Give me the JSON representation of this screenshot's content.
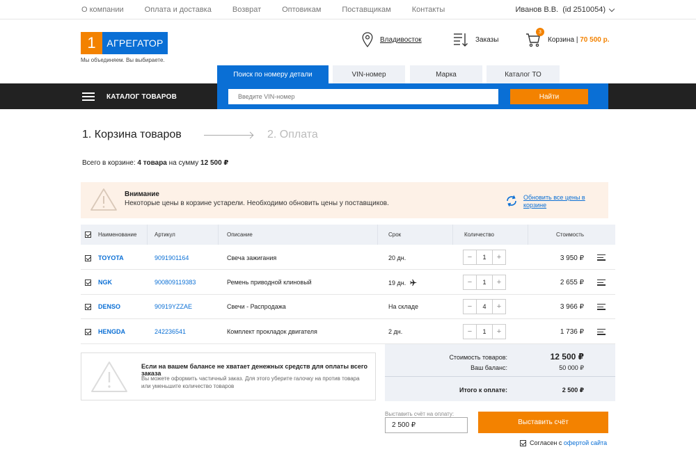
{
  "topnav": [
    "О компании",
    "Оплата и доставка",
    "Возврат",
    "Оптовикам",
    "Поставщикам",
    "Контакты"
  ],
  "user": "Иванов В.В.  (id 2510054)",
  "logo": {
    "num": "1",
    "name": "АГРЕГАТОР",
    "slogan": "Мы объединяем. Вы выбираете."
  },
  "header": {
    "city": "Владивосток",
    "orders": "Заказы",
    "cart_label": "Корзина",
    "cart_sep": " | ",
    "cart_sum": "70 500 р.",
    "cart_count": "3"
  },
  "tabs": [
    "Поиск по номеру детали",
    "VIN-номер",
    "Марка",
    "Каталог ТО"
  ],
  "catalog_label": "КАТАЛОГ ТОВАРОВ",
  "search": {
    "placeholder": "Введите VIN-номер",
    "button": "Найти"
  },
  "steps": {
    "step1": "1. Корзина товаров",
    "step2": "2. Оплата"
  },
  "summary": {
    "prefix": "Всего в корзине: ",
    "count": "4 товара",
    "mid": " на сумму ",
    "sum": "12 500 ₽"
  },
  "warning": {
    "title": "Внимание",
    "text": "Некоторые цены в корзине устарели. Необходимо обновить цены у поставщиков.",
    "refresh": "Обновить все цены в корзине"
  },
  "table": {
    "headers": {
      "name": "Наименование",
      "article": "Артикул",
      "desc": "Описание",
      "term": "Срок",
      "qty": "Количество",
      "cost": "Стоимость"
    },
    "rows": [
      {
        "brand": "TOYOTA",
        "article": "9091901164",
        "desc": "Свеча зажигания",
        "term": "20 дн.",
        "qty": "1",
        "price": "3 950 ₽"
      },
      {
        "brand": "NGK",
        "article": "900809119383",
        "desc": "Ремень приводной клиновый",
        "term": "19 дн.",
        "qty": "1",
        "price": "2 655 ₽"
      },
      {
        "brand": "DENSO",
        "article": "90919YZZAE",
        "desc": "Свечи - Распродажа",
        "term": "На складе",
        "qty": "4",
        "price": "3 966 ₽"
      },
      {
        "brand": "HENGDA",
        "article": "242236541",
        "desc": "Комплект прокладок двигателя",
        "term": "2 дн.",
        "qty": "1",
        "price": "1 736 ₽"
      }
    ]
  },
  "notice": {
    "title": "Если на вашем балансе не хватает денежных средств для оплаты всего заказа",
    "text": "Вы можете оформить частичный заказ. Для этого уберите галочку на против товара или уменьшите количество товаров"
  },
  "totals": {
    "goods_label": "Стоимость товаров:",
    "goods_val": "12 500 ₽",
    "balance_label": "Ваш баланс:",
    "balance_val": "50 000 ₽",
    "total_label": "Итого к оплате:",
    "total_val": "2 500 ₽"
  },
  "invoice": {
    "label": "Выставить счёт на оплату:",
    "value": "2 500 ₽",
    "button": "Выставить счёт"
  },
  "agree": {
    "text": "Согласен с ",
    "link": "офертой сайта"
  },
  "colors": {
    "blue": "#0a6fd5",
    "orange": "#f38200",
    "dark": "#222222"
  }
}
